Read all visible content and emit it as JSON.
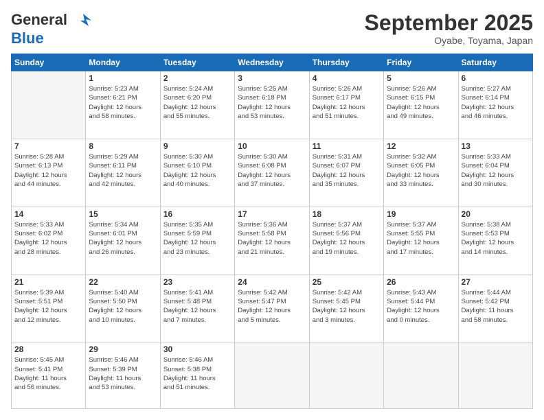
{
  "header": {
    "logo_line1": "General",
    "logo_line2": "Blue",
    "month": "September 2025",
    "location": "Oyabe, Toyama, Japan"
  },
  "weekdays": [
    "Sunday",
    "Monday",
    "Tuesday",
    "Wednesday",
    "Thursday",
    "Friday",
    "Saturday"
  ],
  "weeks": [
    [
      {
        "day": "",
        "info": ""
      },
      {
        "day": "1",
        "info": "Sunrise: 5:23 AM\nSunset: 6:21 PM\nDaylight: 12 hours\nand 58 minutes."
      },
      {
        "day": "2",
        "info": "Sunrise: 5:24 AM\nSunset: 6:20 PM\nDaylight: 12 hours\nand 55 minutes."
      },
      {
        "day": "3",
        "info": "Sunrise: 5:25 AM\nSunset: 6:18 PM\nDaylight: 12 hours\nand 53 minutes."
      },
      {
        "day": "4",
        "info": "Sunrise: 5:26 AM\nSunset: 6:17 PM\nDaylight: 12 hours\nand 51 minutes."
      },
      {
        "day": "5",
        "info": "Sunrise: 5:26 AM\nSunset: 6:15 PM\nDaylight: 12 hours\nand 49 minutes."
      },
      {
        "day": "6",
        "info": "Sunrise: 5:27 AM\nSunset: 6:14 PM\nDaylight: 12 hours\nand 46 minutes."
      }
    ],
    [
      {
        "day": "7",
        "info": "Sunrise: 5:28 AM\nSunset: 6:13 PM\nDaylight: 12 hours\nand 44 minutes."
      },
      {
        "day": "8",
        "info": "Sunrise: 5:29 AM\nSunset: 6:11 PM\nDaylight: 12 hours\nand 42 minutes."
      },
      {
        "day": "9",
        "info": "Sunrise: 5:30 AM\nSunset: 6:10 PM\nDaylight: 12 hours\nand 40 minutes."
      },
      {
        "day": "10",
        "info": "Sunrise: 5:30 AM\nSunset: 6:08 PM\nDaylight: 12 hours\nand 37 minutes."
      },
      {
        "day": "11",
        "info": "Sunrise: 5:31 AM\nSunset: 6:07 PM\nDaylight: 12 hours\nand 35 minutes."
      },
      {
        "day": "12",
        "info": "Sunrise: 5:32 AM\nSunset: 6:05 PM\nDaylight: 12 hours\nand 33 minutes."
      },
      {
        "day": "13",
        "info": "Sunrise: 5:33 AM\nSunset: 6:04 PM\nDaylight: 12 hours\nand 30 minutes."
      }
    ],
    [
      {
        "day": "14",
        "info": "Sunrise: 5:33 AM\nSunset: 6:02 PM\nDaylight: 12 hours\nand 28 minutes."
      },
      {
        "day": "15",
        "info": "Sunrise: 5:34 AM\nSunset: 6:01 PM\nDaylight: 12 hours\nand 26 minutes."
      },
      {
        "day": "16",
        "info": "Sunrise: 5:35 AM\nSunset: 5:59 PM\nDaylight: 12 hours\nand 23 minutes."
      },
      {
        "day": "17",
        "info": "Sunrise: 5:36 AM\nSunset: 5:58 PM\nDaylight: 12 hours\nand 21 minutes."
      },
      {
        "day": "18",
        "info": "Sunrise: 5:37 AM\nSunset: 5:56 PM\nDaylight: 12 hours\nand 19 minutes."
      },
      {
        "day": "19",
        "info": "Sunrise: 5:37 AM\nSunset: 5:55 PM\nDaylight: 12 hours\nand 17 minutes."
      },
      {
        "day": "20",
        "info": "Sunrise: 5:38 AM\nSunset: 5:53 PM\nDaylight: 12 hours\nand 14 minutes."
      }
    ],
    [
      {
        "day": "21",
        "info": "Sunrise: 5:39 AM\nSunset: 5:51 PM\nDaylight: 12 hours\nand 12 minutes."
      },
      {
        "day": "22",
        "info": "Sunrise: 5:40 AM\nSunset: 5:50 PM\nDaylight: 12 hours\nand 10 minutes."
      },
      {
        "day": "23",
        "info": "Sunrise: 5:41 AM\nSunset: 5:48 PM\nDaylight: 12 hours\nand 7 minutes."
      },
      {
        "day": "24",
        "info": "Sunrise: 5:42 AM\nSunset: 5:47 PM\nDaylight: 12 hours\nand 5 minutes."
      },
      {
        "day": "25",
        "info": "Sunrise: 5:42 AM\nSunset: 5:45 PM\nDaylight: 12 hours\nand 3 minutes."
      },
      {
        "day": "26",
        "info": "Sunrise: 5:43 AM\nSunset: 5:44 PM\nDaylight: 12 hours\nand 0 minutes."
      },
      {
        "day": "27",
        "info": "Sunrise: 5:44 AM\nSunset: 5:42 PM\nDaylight: 11 hours\nand 58 minutes."
      }
    ],
    [
      {
        "day": "28",
        "info": "Sunrise: 5:45 AM\nSunset: 5:41 PM\nDaylight: 11 hours\nand 56 minutes."
      },
      {
        "day": "29",
        "info": "Sunrise: 5:46 AM\nSunset: 5:39 PM\nDaylight: 11 hours\nand 53 minutes."
      },
      {
        "day": "30",
        "info": "Sunrise: 5:46 AM\nSunset: 5:38 PM\nDaylight: 11 hours\nand 51 minutes."
      },
      {
        "day": "",
        "info": ""
      },
      {
        "day": "",
        "info": ""
      },
      {
        "day": "",
        "info": ""
      },
      {
        "day": "",
        "info": ""
      }
    ]
  ]
}
